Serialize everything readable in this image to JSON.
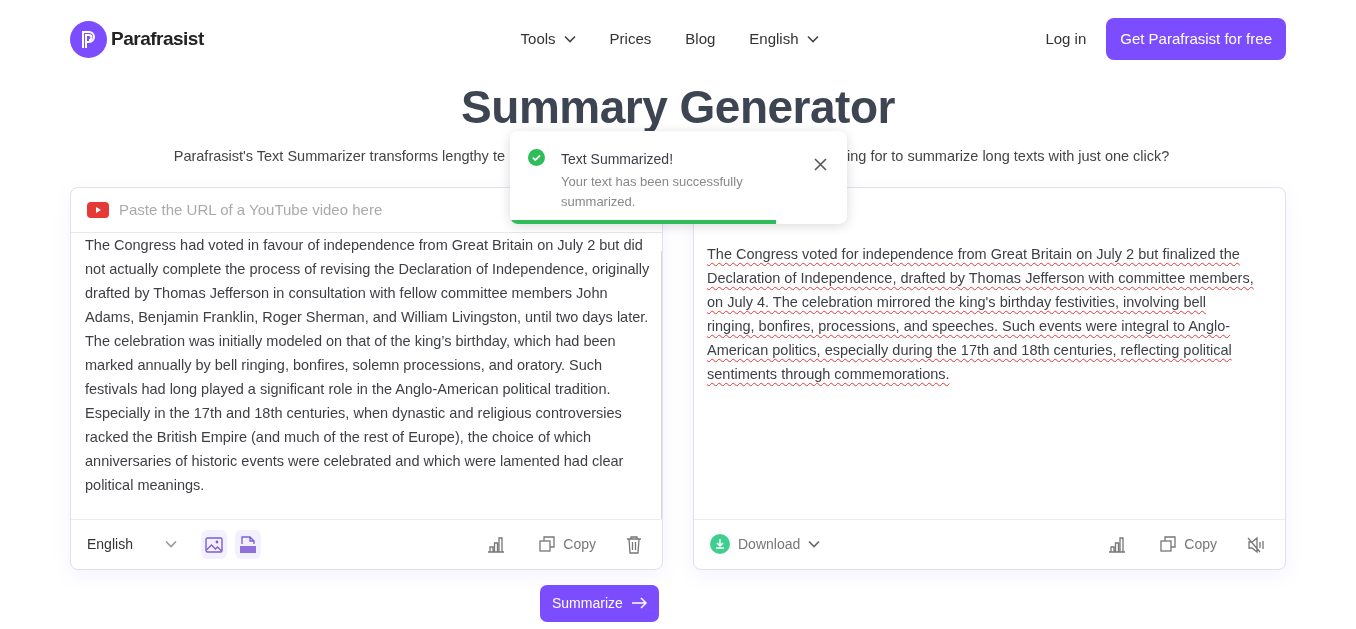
{
  "header": {
    "logo": "Parafrasist",
    "nav": [
      {
        "label": "Tools",
        "dropdown": true
      },
      {
        "label": "Prices",
        "dropdown": false
      },
      {
        "label": "Blog",
        "dropdown": false
      },
      {
        "label": "English",
        "dropdown": true
      }
    ],
    "login": "Log in",
    "cta": "Get Parafrasist for free"
  },
  "title": "Summary Generator",
  "subtitle_parts": [
    "Parafrasist's Text Summarizer transforms lengthy te",
    "ing for to summarize long texts with just one click?"
  ],
  "toast": {
    "title": "Text Summarized!",
    "message": "Your text has been successfully summarized.",
    "level": 0.79
  },
  "input": {
    "url_placeholder": "Paste the URL of a YouTube video here",
    "text": "The Congress had voted in favour of independence from Great Britain on July 2 but did not actually complete the process of revising the Declaration of Independence, originally drafted by Thomas Jefferson in consultation with fellow committee members John Adams, Benjamin Franklin, Roger Sherman, and William Livingston, until two days later. The celebration was initially modeled on that of the king’s birthday, which had been marked annually by bell ringing, bonfires, solemn processions, and oratory. Such festivals had long played a significant role in the Anglo-American political tradition. Especially in the 17th and 18th centuries, when dynastic and religious controversies racked the British Empire (and much of the rest of Europe), the choice of which anniversaries of historic events were celebrated and which were lamented had clear political meanings.",
    "language": "English",
    "copy": "Copy"
  },
  "output": {
    "text": "The Congress voted for independence from Great Britain on July 2 but finalized the Declaration of Independence, drafted by Thomas Jefferson with committee members, on July 4. The celebration mirrored the king's birthday festivities, involving bell ringing, bonfires, processions, and speeches. Such events were integral to Anglo-American politics, especially during the 17th and 18th centuries, reflecting political sentiments through commemorations.",
    "spellcheck_underlines": true,
    "download": "Download",
    "copy": "Copy"
  },
  "summarize_button": "Summarize"
}
